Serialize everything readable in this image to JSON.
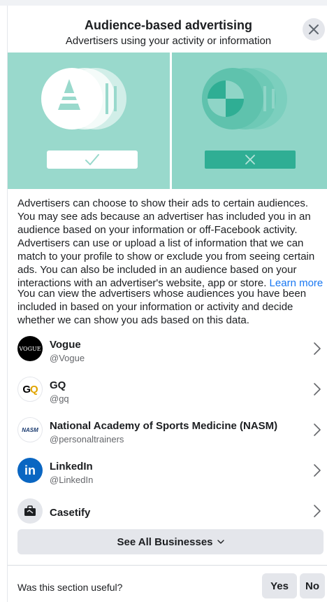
{
  "header": {
    "title": "Audience-based advertising",
    "subtitle": "Advertisers using your activity or information"
  },
  "icons": {
    "close": "close-icon",
    "chevron": "chevron-right-icon",
    "dropdown": "chevron-down-icon"
  },
  "colors": {
    "hero_bg": "#99d9cc",
    "hero_accent": "#2fae94",
    "link": "#1877f2"
  },
  "body": {
    "paragraph1": "Advertisers can choose to show their ads to certain audiences. You may see ads because an advertiser has included you in an audience based on your information or off-Facebook activity. Advertisers can use or upload a list of information that we can match to your profile to show or exclude you from seeing certain ads. You can also be included in an audience based on your interactions with an advertiser's website, app or store.",
    "learn_more": "Learn more",
    "paragraph2": "You can view the advertisers whose audiences you have been included in based on your information or activity and decide whether we can show you ads based on this data."
  },
  "businesses": [
    {
      "name": "Vogue",
      "handle": "@Vogue",
      "logo_text": "VOGUE"
    },
    {
      "name": "GQ",
      "handle": "@gq",
      "logo_text": "GQ"
    },
    {
      "name": "National Academy of Sports Medicine (NASM)",
      "handle": "@personaltrainers",
      "logo_text": "NASM"
    },
    {
      "name": "LinkedIn",
      "handle": "@LinkedIn",
      "logo_text": "in"
    },
    {
      "name": "Casetify",
      "handle": "",
      "logo_text": ""
    }
  ],
  "see_all_label": "See All Businesses",
  "footer": {
    "question": "Was this section useful?",
    "yes": "Yes",
    "no": "No"
  }
}
